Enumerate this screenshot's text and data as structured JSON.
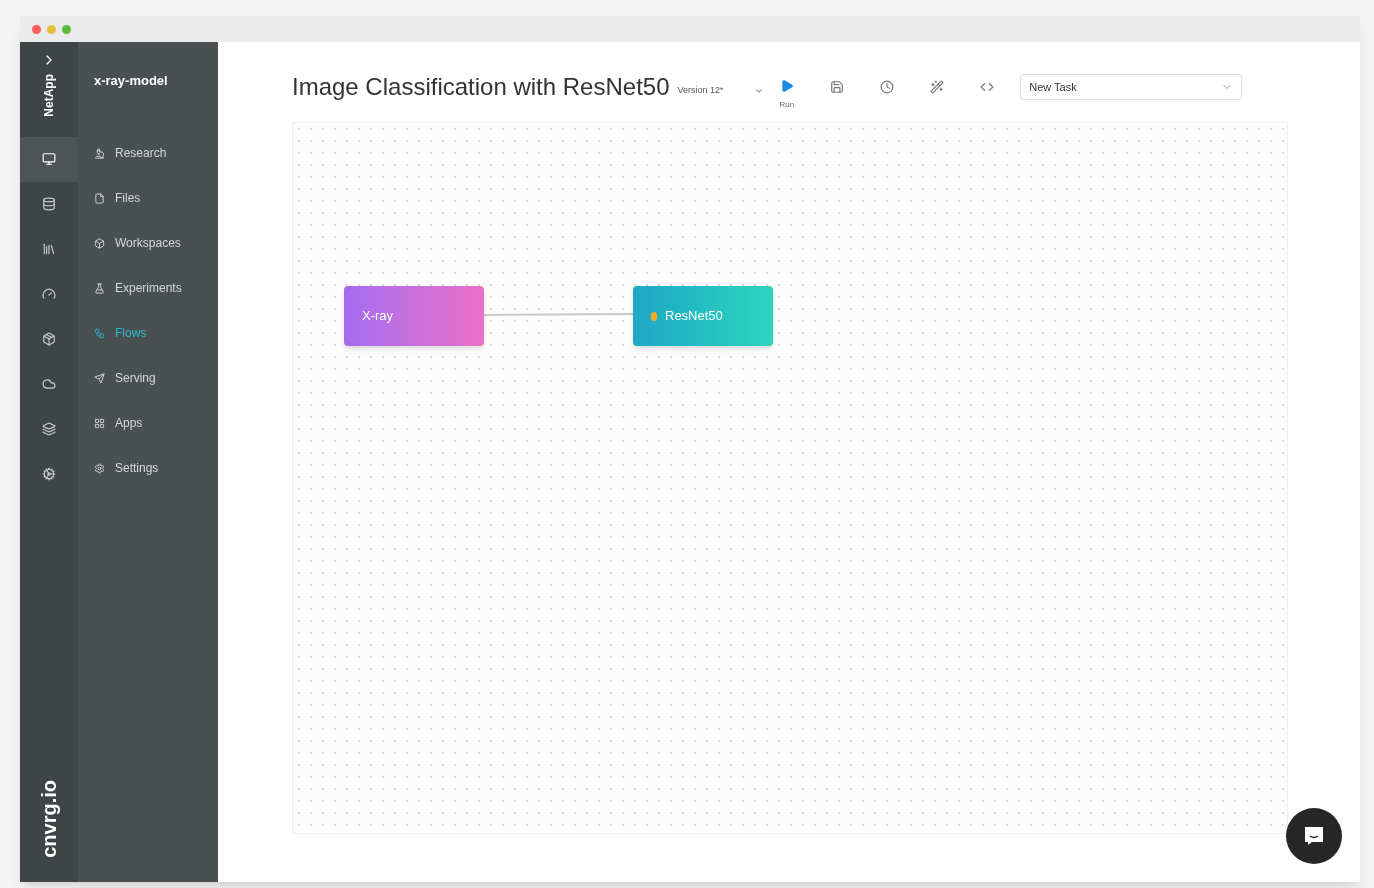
{
  "brand": {
    "org": "NetApp",
    "logo": "cnvrg.io"
  },
  "rail": [
    {
      "selected": true
    },
    {
      "selected": false
    },
    {
      "selected": false
    },
    {
      "selected": false
    },
    {
      "selected": false
    },
    {
      "selected": false
    },
    {
      "selected": false
    },
    {
      "selected": false
    }
  ],
  "project": "x-ray-model",
  "sidebar": {
    "items": [
      {
        "label": "Research",
        "selected": false
      },
      {
        "label": "Files",
        "selected": false
      },
      {
        "label": "Workspaces",
        "selected": false
      },
      {
        "label": "Experiments",
        "selected": false
      },
      {
        "label": "Flows",
        "selected": true
      },
      {
        "label": "Serving",
        "selected": false
      },
      {
        "label": "Apps",
        "selected": false
      },
      {
        "label": "Settings",
        "selected": false
      }
    ]
  },
  "header": {
    "title": "Image Classification with ResNet50",
    "version": "Version 12*",
    "run_label": "Run",
    "task_select": {
      "value": "New Task"
    }
  },
  "flow": {
    "nodes": [
      {
        "label": "X-ray",
        "kind": "data"
      },
      {
        "label": "ResNet50",
        "kind": "task"
      }
    ]
  }
}
